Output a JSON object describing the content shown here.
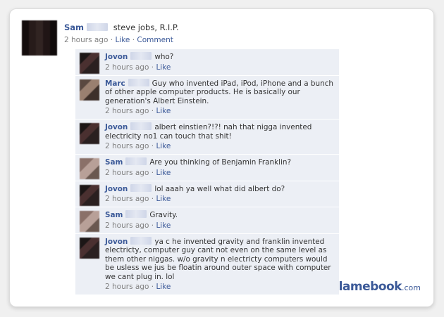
{
  "post": {
    "author": "Sam",
    "text": "steve jobs, R.I.P.",
    "time": "2 hours ago",
    "separator": "·",
    "like": "Like",
    "comment": "Comment"
  },
  "comments": [
    {
      "author": "Jovon",
      "text": "who?",
      "time": "2 hours ago",
      "like": "Like"
    },
    {
      "author": "Marc",
      "text": "Guy who invented iPad, iPod, iPhone and a bunch of other apple computer products. He is basically our generation's Albert Einstein.",
      "time": "2 hours ago",
      "like": "Like"
    },
    {
      "author": "Jovon",
      "text": "albert einstien?!?! nah that nigga invented electricity no1 can touch that shit!",
      "time": "2 hours ago",
      "like": "Like"
    },
    {
      "author": "Sam",
      "text": "Are you thinking of Benjamin Franklin?",
      "time": "2 hours ago",
      "like": "Like"
    },
    {
      "author": "Jovon",
      "text": "lol aaah ya well what did albert do?",
      "time": "2 hours ago",
      "like": "Like"
    },
    {
      "author": "Sam",
      "text": "Gravity.",
      "time": "2 hours ago",
      "like": "Like"
    },
    {
      "author": "Jovon",
      "text": "ya c he invented gravity and franklin invented electricty, computer guy cant not even on the same level as them other niggas. w/o gravity n electricty computers would be usless we jus be floatin around outer space with computer we cant plug in. lol",
      "time": "2 hours ago",
      "like": "Like"
    }
  ],
  "watermark": {
    "brand": "lamebook",
    "suffix": ".com"
  }
}
